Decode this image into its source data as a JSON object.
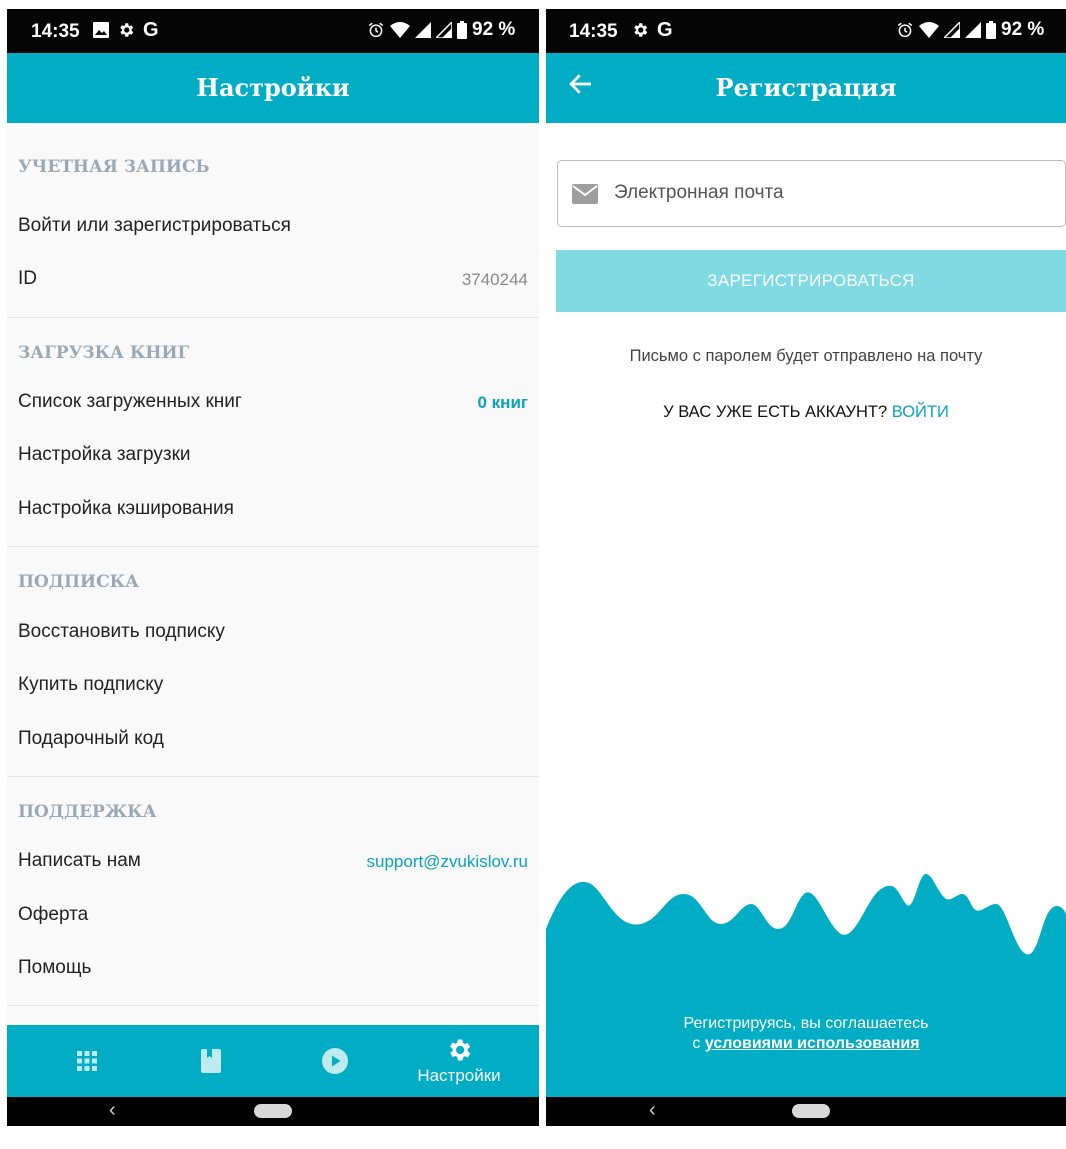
{
  "left": {
    "status": {
      "time": "14:35",
      "battery": "92 %"
    },
    "title": "Настройки",
    "sections": [
      {
        "header": "УЧЕТНАЯ ЗАПИСЬ",
        "rows": [
          {
            "label": "Войти или зарегистрироваться",
            "value": ""
          },
          {
            "label": "ID",
            "value": "3740244"
          }
        ]
      },
      {
        "header": "ЗАГРУЗКА КНИГ",
        "rows": [
          {
            "label": "Список загруженных книг",
            "value": "0 книг"
          },
          {
            "label": "Настройка загрузки",
            "value": ""
          },
          {
            "label": "Настройка кэширования",
            "value": ""
          }
        ]
      },
      {
        "header": "ПОДПИСКА",
        "rows": [
          {
            "label": "Восстановить подписку",
            "value": ""
          },
          {
            "label": "Купить подписку",
            "value": ""
          },
          {
            "label": "Подарочный код",
            "value": ""
          }
        ]
      },
      {
        "header": "ПОДДЕРЖКА",
        "rows": [
          {
            "label": "Написать нам",
            "value": "support@zvukislov.ru"
          },
          {
            "label": "Оферта",
            "value": ""
          },
          {
            "label": "Помощь",
            "value": ""
          }
        ]
      }
    ],
    "bottom_nav": [
      {
        "icon": "grid-icon",
        "label": ""
      },
      {
        "icon": "book-icon",
        "label": ""
      },
      {
        "icon": "play-icon",
        "label": ""
      },
      {
        "icon": "gear-icon",
        "label": "Настройки"
      }
    ]
  },
  "right": {
    "status": {
      "time": "14:35",
      "battery": "92 %"
    },
    "title": "Регистрация",
    "email_placeholder": "Электронная почта",
    "register_button": "ЗАРЕГИСТРИРОВАТЬСЯ",
    "note": "Письмо с паролем будет отправлено на почту",
    "have_account": "У ВАС УЖЕ ЕСТЬ АККАУНТ?",
    "login_link": "ВОЙТИ",
    "terms_line1": "Регистрируясь, вы соглашаетесь",
    "terms_prefix": "с",
    "terms_link": "условиями использования"
  },
  "colors": {
    "accent": "#00adc4",
    "link": "#0aa3bd",
    "button_disabled": "#80dae3",
    "section_header": "#9aa9b6"
  }
}
